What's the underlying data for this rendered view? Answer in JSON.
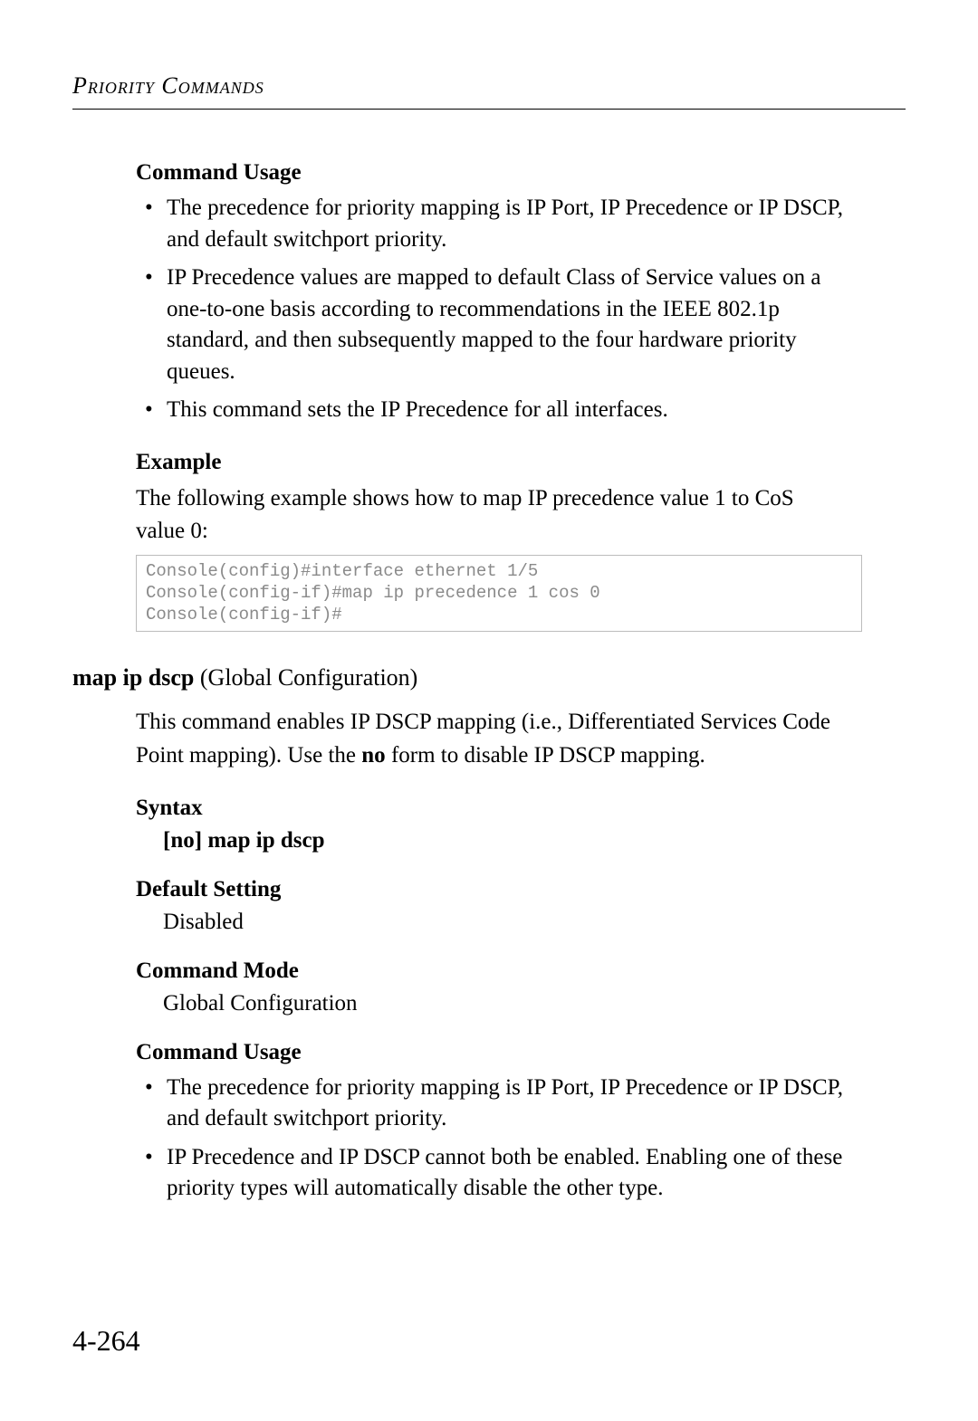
{
  "header": "Priority Commands",
  "section1": {
    "heading": "Command Usage",
    "bullets": [
      "The precedence for priority mapping is IP Port, IP Precedence or IP DSCP, and default switchport priority.",
      "IP Precedence values are mapped to default Class of Service values on a one-to-one basis according to recommendations in the IEEE 802.1p standard, and then subsequently mapped to the four hardware priority queues.",
      "This command sets the IP Precedence for all interfaces."
    ]
  },
  "example": {
    "heading": "Example",
    "intro": "The following example shows how to map IP precedence value 1 to CoS value 0:",
    "code": "Console(config)#interface ethernet 1/5\nConsole(config-if)#map ip precedence 1 cos 0\nConsole(config-if)#"
  },
  "cmd": {
    "name": "map ip dscp",
    "context": " (Global Configuration)",
    "description_pre": "This command enables IP DSCP mapping (i.e., Differentiated Services Code Point mapping). Use the ",
    "description_bold": "no",
    "description_post": " form to disable IP DSCP mapping."
  },
  "syntax": {
    "heading": "Syntax",
    "open_bracket": "[",
    "no_kw": "no",
    "close_bracket": "]",
    "cmd_kw": " map ip dscp"
  },
  "default_setting": {
    "heading": "Default Setting",
    "value": "Disabled"
  },
  "command_mode": {
    "heading": "Command Mode",
    "value": "Global Configuration"
  },
  "section2": {
    "heading": "Command Usage",
    "bullets": [
      "The precedence for priority mapping is IP Port, IP Precedence or IP DSCP, and default switchport priority.",
      "IP Precedence and IP DSCP cannot both be enabled. Enabling one of these priority types will automatically disable the other type."
    ]
  },
  "page_number": "4-264"
}
